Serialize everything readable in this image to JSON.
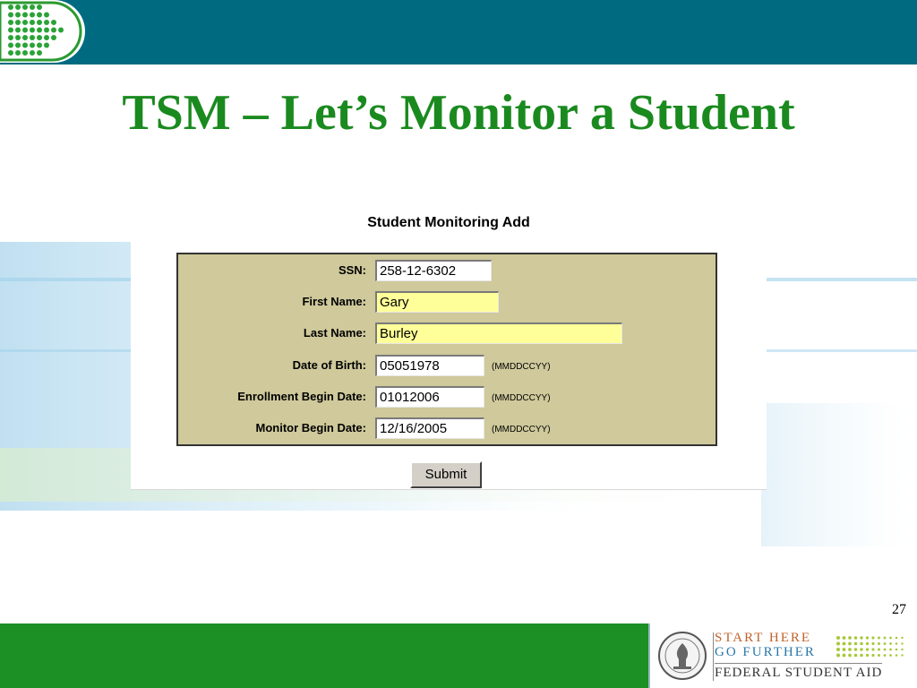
{
  "slide": {
    "title": "TSM – Let’s Monitor a Student",
    "page_number": "27"
  },
  "form": {
    "title": "Student Monitoring Add",
    "fields": [
      {
        "label": "SSN:",
        "value": "258-12-6302",
        "format": ""
      },
      {
        "label": "First Name:",
        "value": "Gary",
        "format": ""
      },
      {
        "label": "Last Name:",
        "value": "Burley",
        "format": ""
      },
      {
        "label": "Date of Birth:",
        "value": "05051978",
        "format": "(MMDDCCYY)"
      },
      {
        "label": "Enrollment Begin Date:",
        "value": "01012006",
        "format": "(MMDDCCYY)"
      },
      {
        "label": "Monitor Begin Date:",
        "value": "12/16/2005",
        "format": "(MMDDCCYY)"
      }
    ],
    "submit_label": "Submit"
  },
  "footer": {
    "line1": "START HERE",
    "line2": "GO FURTHER",
    "line3": "FEDERAL STUDENT AID"
  },
  "colors": {
    "header_bar": "#006b80",
    "title_green": "#1a8a1f",
    "form_background": "#cfc99b",
    "highlight_yellow": "#ffff99",
    "footer_green": "#1c8f25"
  },
  "icons": {
    "top_logo": "green-dot-grid-logo-icon",
    "seal": "department-of-education-seal-icon"
  }
}
